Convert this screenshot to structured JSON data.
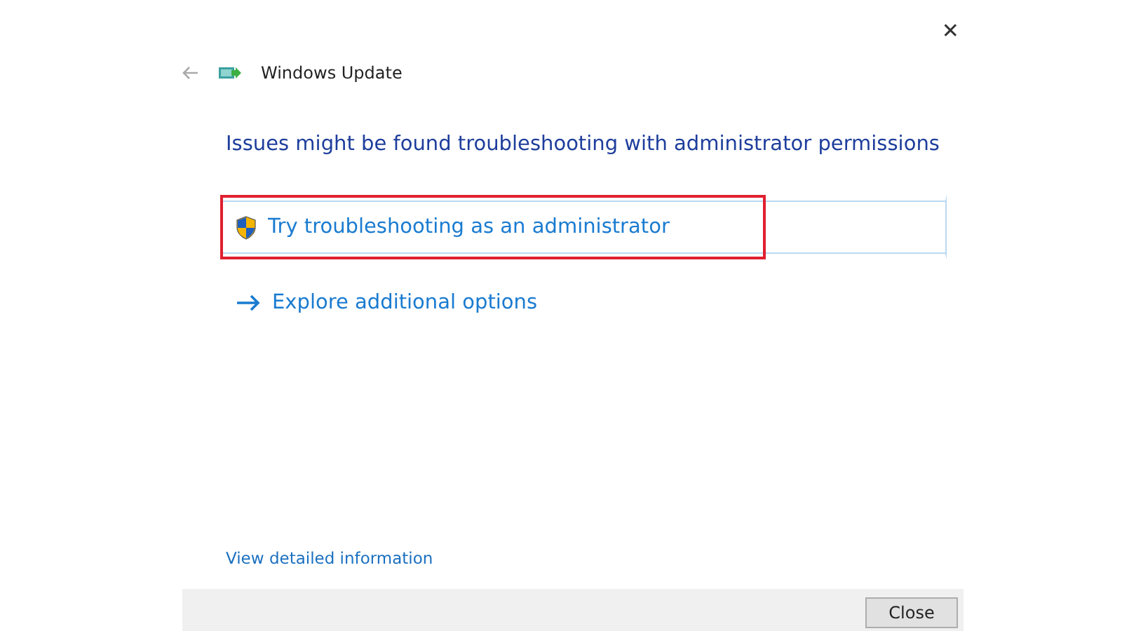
{
  "window": {
    "close_glyph": "✕"
  },
  "header": {
    "title": "Windows Update"
  },
  "heading": "Issues might be found troubleshooting with administrator permissions",
  "options": [
    {
      "kind": "admin",
      "label": "Try troubleshooting as an administrator",
      "focused": true,
      "highlighted": true
    },
    {
      "kind": "arrow",
      "label": "Explore additional options",
      "focused": false,
      "highlighted": false
    }
  ],
  "details_link": "View detailed information",
  "footer": {
    "buttons": [
      "Close"
    ]
  }
}
